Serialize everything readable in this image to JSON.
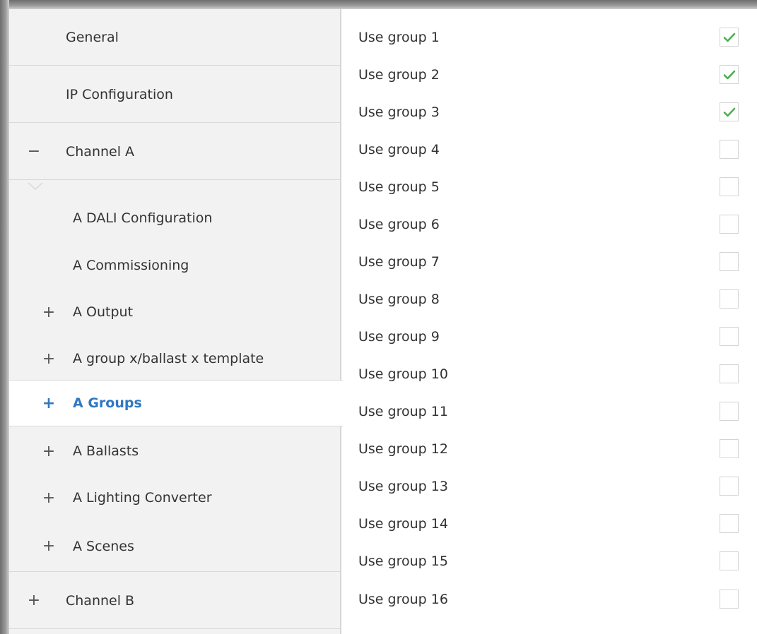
{
  "sidebar": {
    "items": [
      {
        "label": "General",
        "symbol": ""
      },
      {
        "label": "IP Configuration",
        "symbol": ""
      },
      {
        "label": "Channel A",
        "symbol": "−"
      },
      {
        "label": "A DALI Configuration",
        "symbol": ""
      },
      {
        "label": "A Commissioning",
        "symbol": ""
      },
      {
        "label": "A Output",
        "symbol": "+"
      },
      {
        "label": "A group x/ballast x template",
        "symbol": "+"
      },
      {
        "label": "A Groups",
        "symbol": "+"
      },
      {
        "label": "A Ballasts",
        "symbol": "+"
      },
      {
        "label": "A Lighting Converter",
        "symbol": "+"
      },
      {
        "label": "A Scenes",
        "symbol": "+"
      },
      {
        "label": "Channel B",
        "symbol": "+"
      }
    ],
    "selected": "A Groups"
  },
  "groups": [
    {
      "label": "Use group 1",
      "checked": true
    },
    {
      "label": "Use group 2",
      "checked": true
    },
    {
      "label": "Use group 3",
      "checked": true
    },
    {
      "label": "Use group 4",
      "checked": false
    },
    {
      "label": "Use group 5",
      "checked": false
    },
    {
      "label": "Use group 6",
      "checked": false
    },
    {
      "label": "Use group 7",
      "checked": false
    },
    {
      "label": "Use group 8",
      "checked": false
    },
    {
      "label": "Use group 9",
      "checked": false
    },
    {
      "label": "Use group 10",
      "checked": false
    },
    {
      "label": "Use group 11",
      "checked": false
    },
    {
      "label": "Use group 12",
      "checked": false
    },
    {
      "label": "Use group 13",
      "checked": false
    },
    {
      "label": "Use group 14",
      "checked": false
    },
    {
      "label": "Use group 15",
      "checked": false
    },
    {
      "label": "Use group 16",
      "checked": false
    }
  ],
  "colors": {
    "accent": "#2f78c4",
    "check": "#4caf50",
    "sidebar_bg": "#f2f2f2"
  },
  "icons": {
    "expand": "plus-icon",
    "collapse": "minus-icon",
    "checked": "checkmark-icon"
  }
}
